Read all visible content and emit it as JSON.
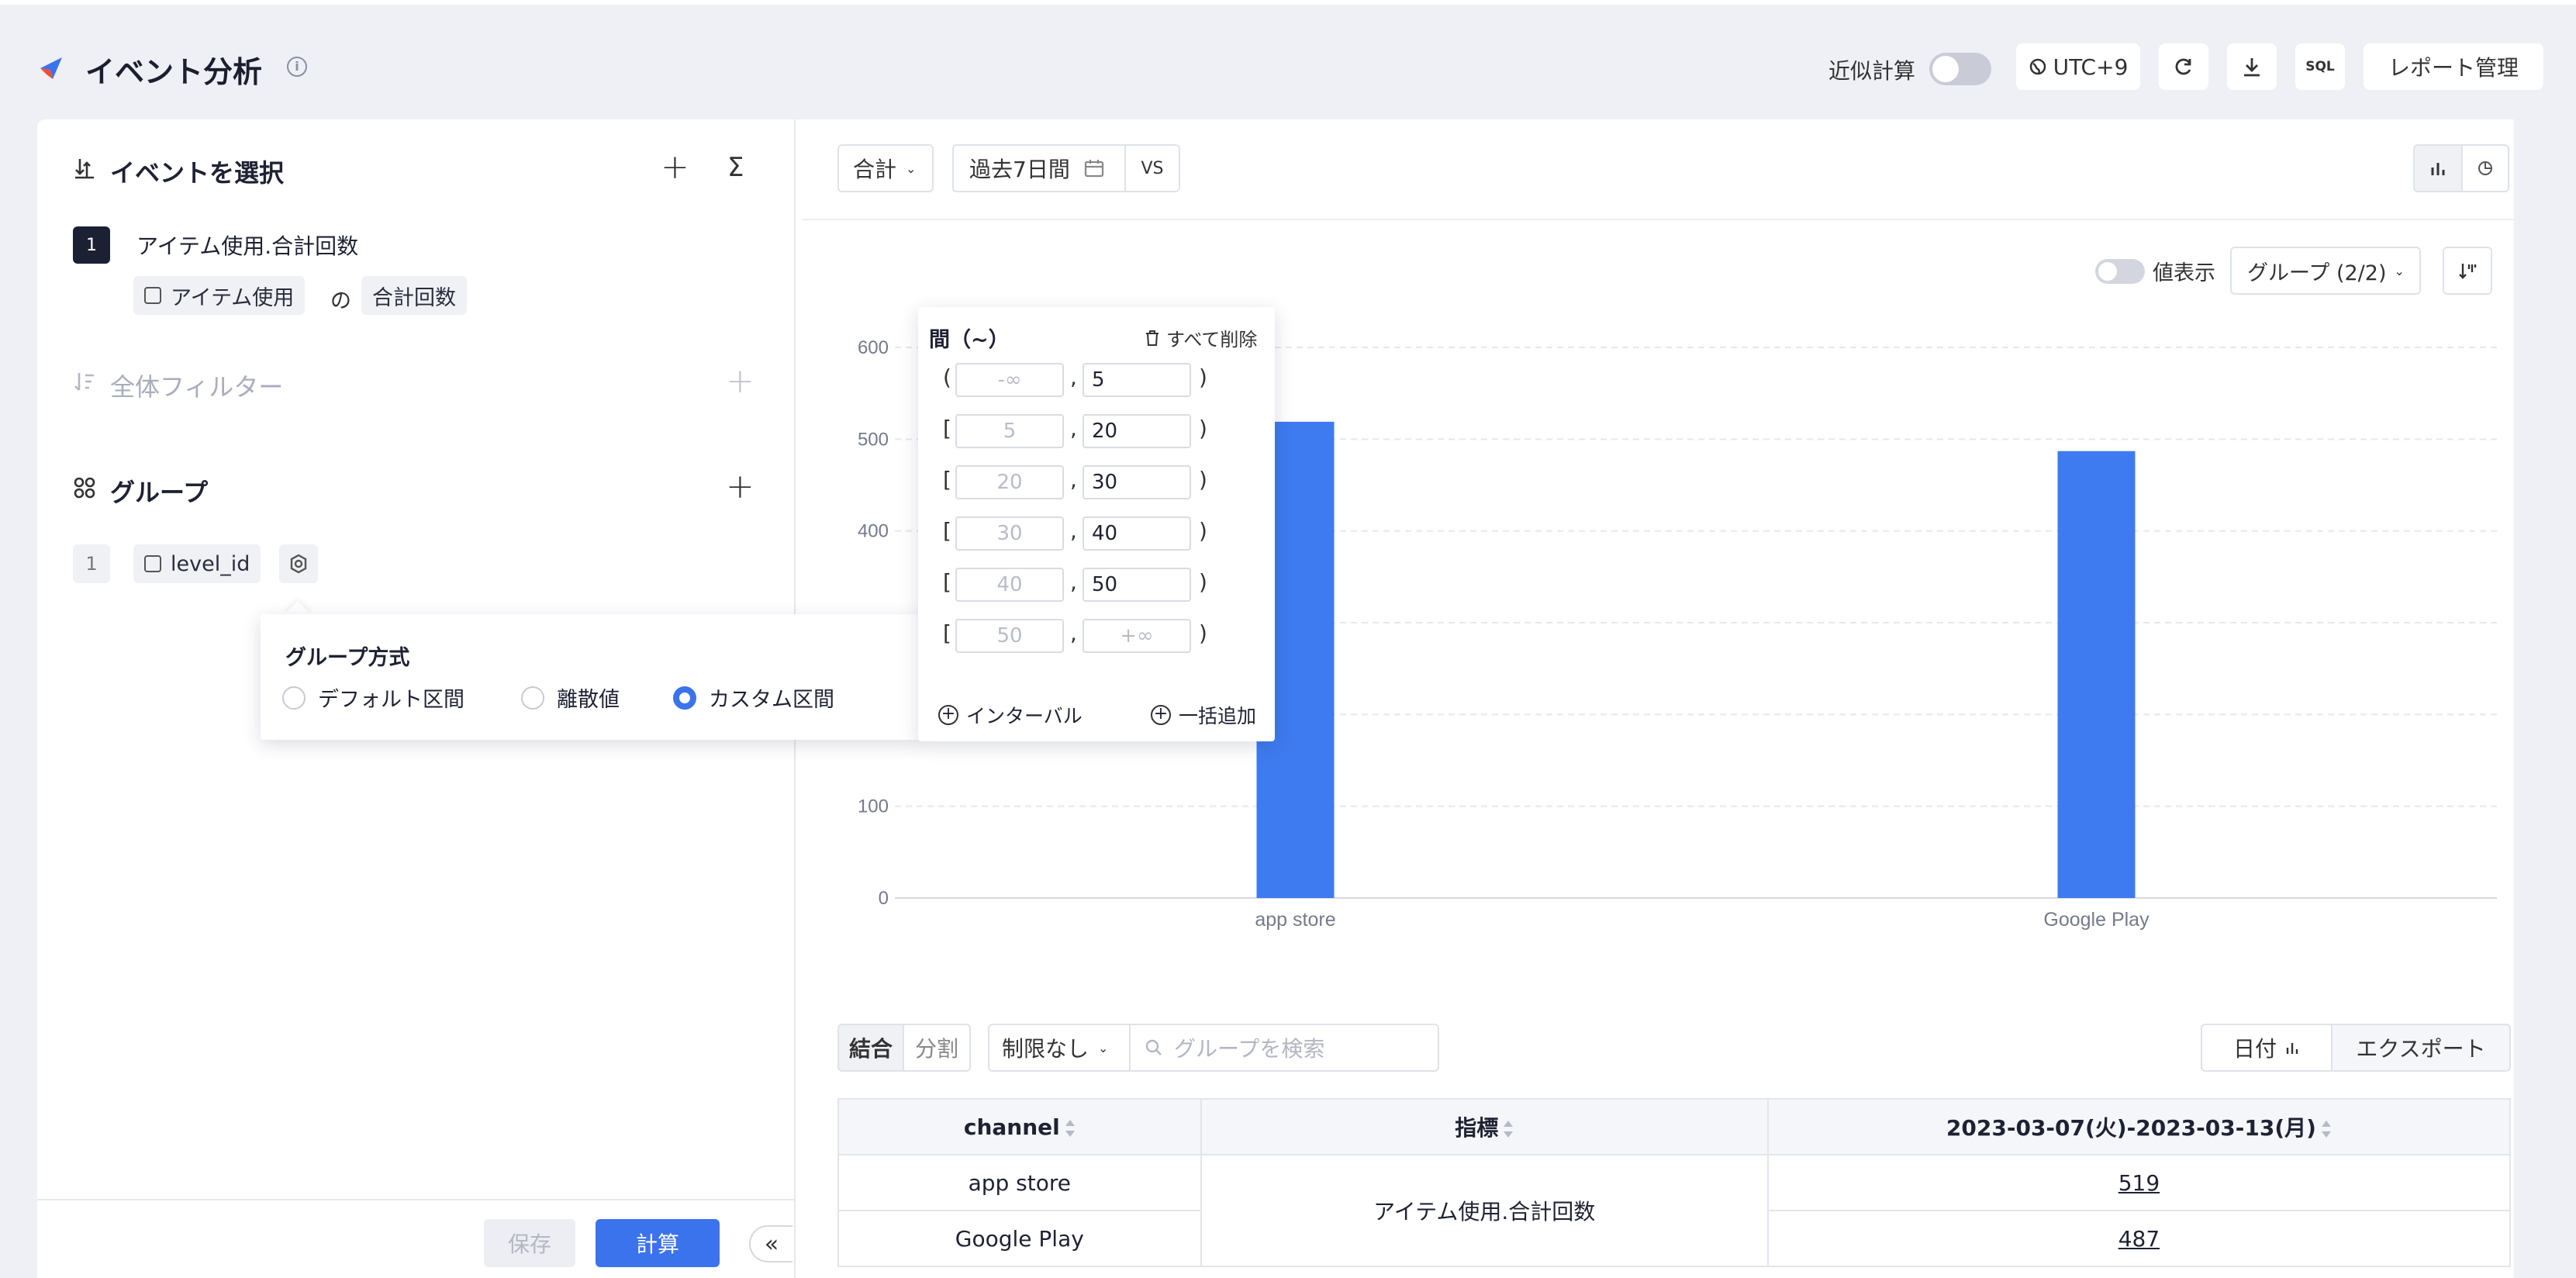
{
  "header": {
    "title": "イベント分析",
    "approx_label": "近似計算",
    "timezone": "UTC+9",
    "sql_label": "SQL",
    "report_manage": "レポート管理"
  },
  "left": {
    "events_title": "イベントを選択",
    "event_index": "1",
    "event_name": "アイテム使用.合計回数",
    "event_chip": "アイテム使用",
    "of_label": "の",
    "metric_chip": "合計回数",
    "filter_title": "全体フィルター",
    "group_title": "グループ",
    "group_index": "1",
    "group_field": "level_id",
    "save": "保存",
    "calc": "計算",
    "collapse": "«"
  },
  "group_popover": {
    "title": "グループ方式",
    "options": [
      "デフォルト区間",
      "離散値",
      "カスタム区間"
    ],
    "selected": "カスタム区間"
  },
  "interval_popover": {
    "title": "間（~）",
    "delete_all": "すべて削除",
    "rows": [
      {
        "open": "(",
        "from": "-∞",
        "to": "5",
        "close": ")"
      },
      {
        "open": "[",
        "from": "5",
        "to": "20",
        "close": ")"
      },
      {
        "open": "[",
        "from": "20",
        "to": "30",
        "close": ")"
      },
      {
        "open": "[",
        "from": "30",
        "to": "40",
        "close": ")"
      },
      {
        "open": "[",
        "from": "40",
        "to": "50",
        "close": ")"
      },
      {
        "open": "[",
        "from": "50",
        "to": "+∞",
        "close": ")"
      }
    ],
    "add_interval": "インターバル",
    "bulk_add": "一括追加"
  },
  "toolbar": {
    "agg": "合計",
    "range": "過去7日間",
    "vs": "VS",
    "value_display": "値表示",
    "group_select": "グループ (2/2)"
  },
  "chart_data": {
    "type": "bar",
    "categories": [
      "app store",
      "Google Play"
    ],
    "values": [
      519,
      487
    ],
    "yticks": [
      "0",
      "100",
      "400",
      "500",
      "600"
    ],
    "ylim": [
      0,
      600
    ],
    "color": "#3e7bf0"
  },
  "table_toolbar": {
    "merge": "結合",
    "split": "分割",
    "limit": "制限なし",
    "search_placeholder": "グループを検索",
    "date": "日付",
    "export": "エクスポート"
  },
  "table": {
    "headers": [
      "channel",
      "指標",
      "2023-03-07(火)-2023-03-13(月)"
    ],
    "rows": [
      {
        "channel": "app store",
        "metric": "アイテム使用.合計回数",
        "value": "519"
      },
      {
        "channel": "Google Play",
        "metric": "アイテム使用.合計回数",
        "value": "487"
      }
    ]
  }
}
